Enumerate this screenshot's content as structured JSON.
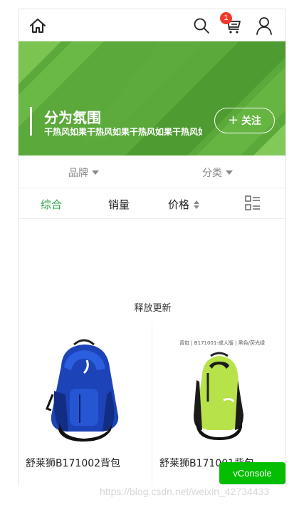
{
  "header": {
    "icons": [
      "home-icon",
      "search-icon",
      "cart-icon",
      "user-icon"
    ],
    "cart_badge": "1"
  },
  "banner": {
    "title": "分为氛围",
    "subtitle": "干热风如果干热风如果干热风如果干热风如果干热风如果",
    "follow_label": "关注",
    "background_color": "#5aa93a"
  },
  "filters": [
    {
      "label": "品牌"
    },
    {
      "label": "分类"
    }
  ],
  "sort": {
    "tabs": [
      {
        "label": "综合",
        "active": true
      },
      {
        "label": "销量",
        "active": false
      },
      {
        "label": "价格",
        "active": false
      }
    ],
    "accent_color": "#2ca145"
  },
  "refresh_text": "释放更新",
  "products": [
    {
      "name": "舒莱狮B171002背包",
      "color": "blue"
    },
    {
      "name": "舒莱狮B171001背包",
      "caption": "背包 | B171001-成人版 | 黑色/荧光绿",
      "color": "lime-green"
    }
  ],
  "vconsole_label": "vConsole",
  "watermark": "https://blog.csdn.net/weixin_42734433"
}
